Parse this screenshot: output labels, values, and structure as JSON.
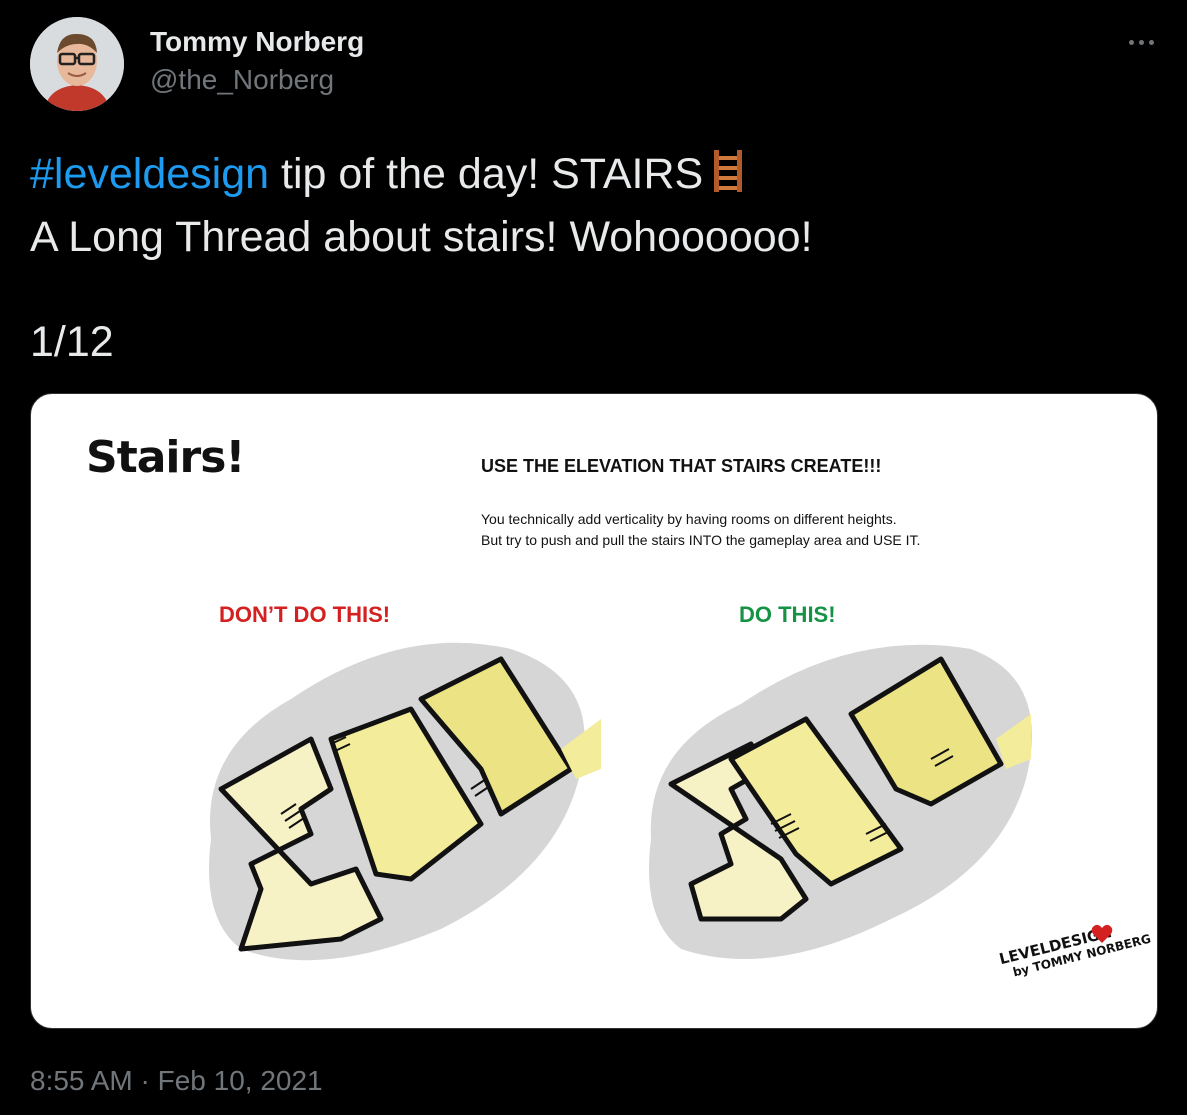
{
  "author": {
    "name": "Tommy Norberg",
    "handle": "@the_Norberg",
    "avatar_icon": "user-avatar"
  },
  "tweet": {
    "hashtag": "#leveldesign",
    "line1_rest": " tip of the day! STAIRS",
    "line1_emoji": "ladder-icon",
    "line2": "A Long Thread about stairs! Wohoooooo!",
    "counter": "1/12"
  },
  "media": {
    "title": "Stairs!",
    "heading": "USE THE ELEVATION THAT STAIRS CREATE!!!",
    "body_line1": "You technically add verticality by having rooms on different heights.",
    "body_line2": "But try to push and pull the stairs INTO the gameplay area and USE IT.",
    "label_dont": "DON’T DO THIS!",
    "label_do": "DO THIS!",
    "signature_line1": "LEVELDESIGN",
    "signature_line2": "by TOMMY NORBERG",
    "colors": {
      "dont": "#d42020",
      "do": "#169245",
      "room": "#f3ec9a"
    }
  },
  "meta": {
    "timestamp": "8:55 AM · Feb 10, 2021"
  },
  "colors": {
    "hashtag": "#1d9bf0",
    "text": "#e7e9ea",
    "muted": "#71767b"
  }
}
